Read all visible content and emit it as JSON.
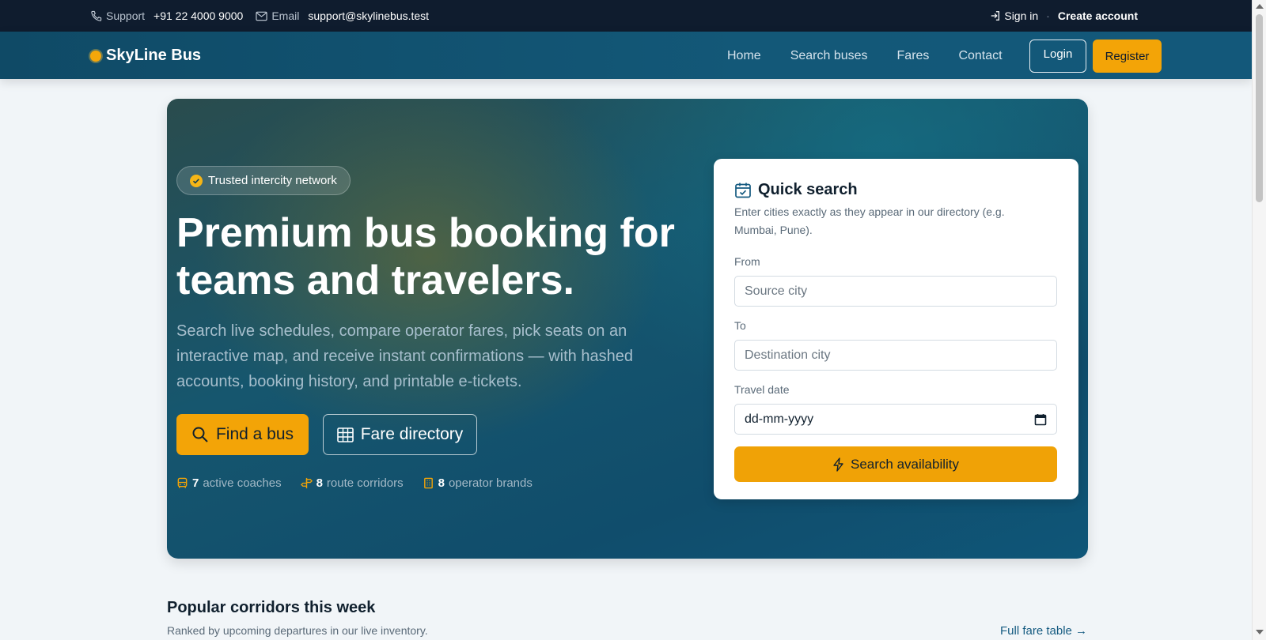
{
  "topbar": {
    "support_label": "Support",
    "support_phone": "+91 22 4000 9000",
    "email_label": "Email",
    "email_value": "support@skylinebus.test",
    "sign_in": "Sign in",
    "separator": "·",
    "create_account": "Create account"
  },
  "navbar": {
    "brand": "SkyLine Bus",
    "links": [
      "Home",
      "Search buses",
      "Fares",
      "Contact"
    ],
    "login": "Login",
    "register": "Register"
  },
  "hero": {
    "badge": "Trusted intercity network",
    "title": "Premium bus booking for teams and travelers.",
    "subtitle": "Search live schedules, compare operator fares, pick seats on an interactive map, and receive instant confirmations — with hashed accounts, booking history, and printable e-tickets.",
    "find_button": "Find a bus",
    "fare_button": "Fare directory",
    "stats": [
      {
        "value": "7",
        "label": "active coaches",
        "icon": "bus-icon"
      },
      {
        "value": "8",
        "label": "route corridors",
        "icon": "signpost-icon"
      },
      {
        "value": "8",
        "label": "operator brands",
        "icon": "building-icon"
      }
    ]
  },
  "quick_search": {
    "title": "Quick search",
    "description": "Enter cities exactly as they appear in our directory (e.g. Mumbai, Pune).",
    "from_label": "From",
    "from_placeholder": "Source city",
    "to_label": "To",
    "to_placeholder": "Destination city",
    "date_label": "Travel date",
    "date_placeholder": "dd-mm-yyyy",
    "submit": "Search availability"
  },
  "section": {
    "title": "Popular corridors this week",
    "subtitle": "Ranked by upcoming departures in our live inventory.",
    "link": "Full fare table →"
  },
  "colors": {
    "accent": "#f3a407",
    "topbar_bg": "#0f1c2e",
    "navbar_bg": "#135878",
    "link": "#145a80"
  }
}
